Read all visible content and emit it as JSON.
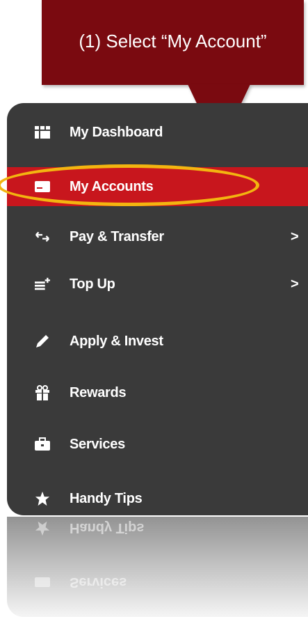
{
  "callout": {
    "text": "(1) Select “My Account”"
  },
  "menu": {
    "items": [
      {
        "label": "My Dashboard",
        "icon": "dashboard-grid-icon"
      },
      {
        "label": "My Accounts",
        "icon": "account-card-icon",
        "active": true
      },
      {
        "label": "Pay & Transfer",
        "icon": "transfer-arrows-icon",
        "chevron": ">"
      },
      {
        "label": "Top Up",
        "icon": "top-up-icon",
        "chevron": ">"
      },
      {
        "label": "Apply & Invest",
        "icon": "pencil-icon"
      },
      {
        "label": "Rewards",
        "icon": "gift-icon"
      },
      {
        "label": "Services",
        "icon": "briefcase-icon"
      },
      {
        "label": "Handy Tips",
        "icon": "star-icon"
      }
    ]
  },
  "reflection": {
    "items": [
      {
        "label": "Handy Tips"
      },
      {
        "label": "Services"
      }
    ]
  },
  "colors": {
    "callout": "#7a0a10",
    "menu_bg": "#3a3a3a",
    "active": "#c8161d",
    "highlight": "#f3b510"
  }
}
